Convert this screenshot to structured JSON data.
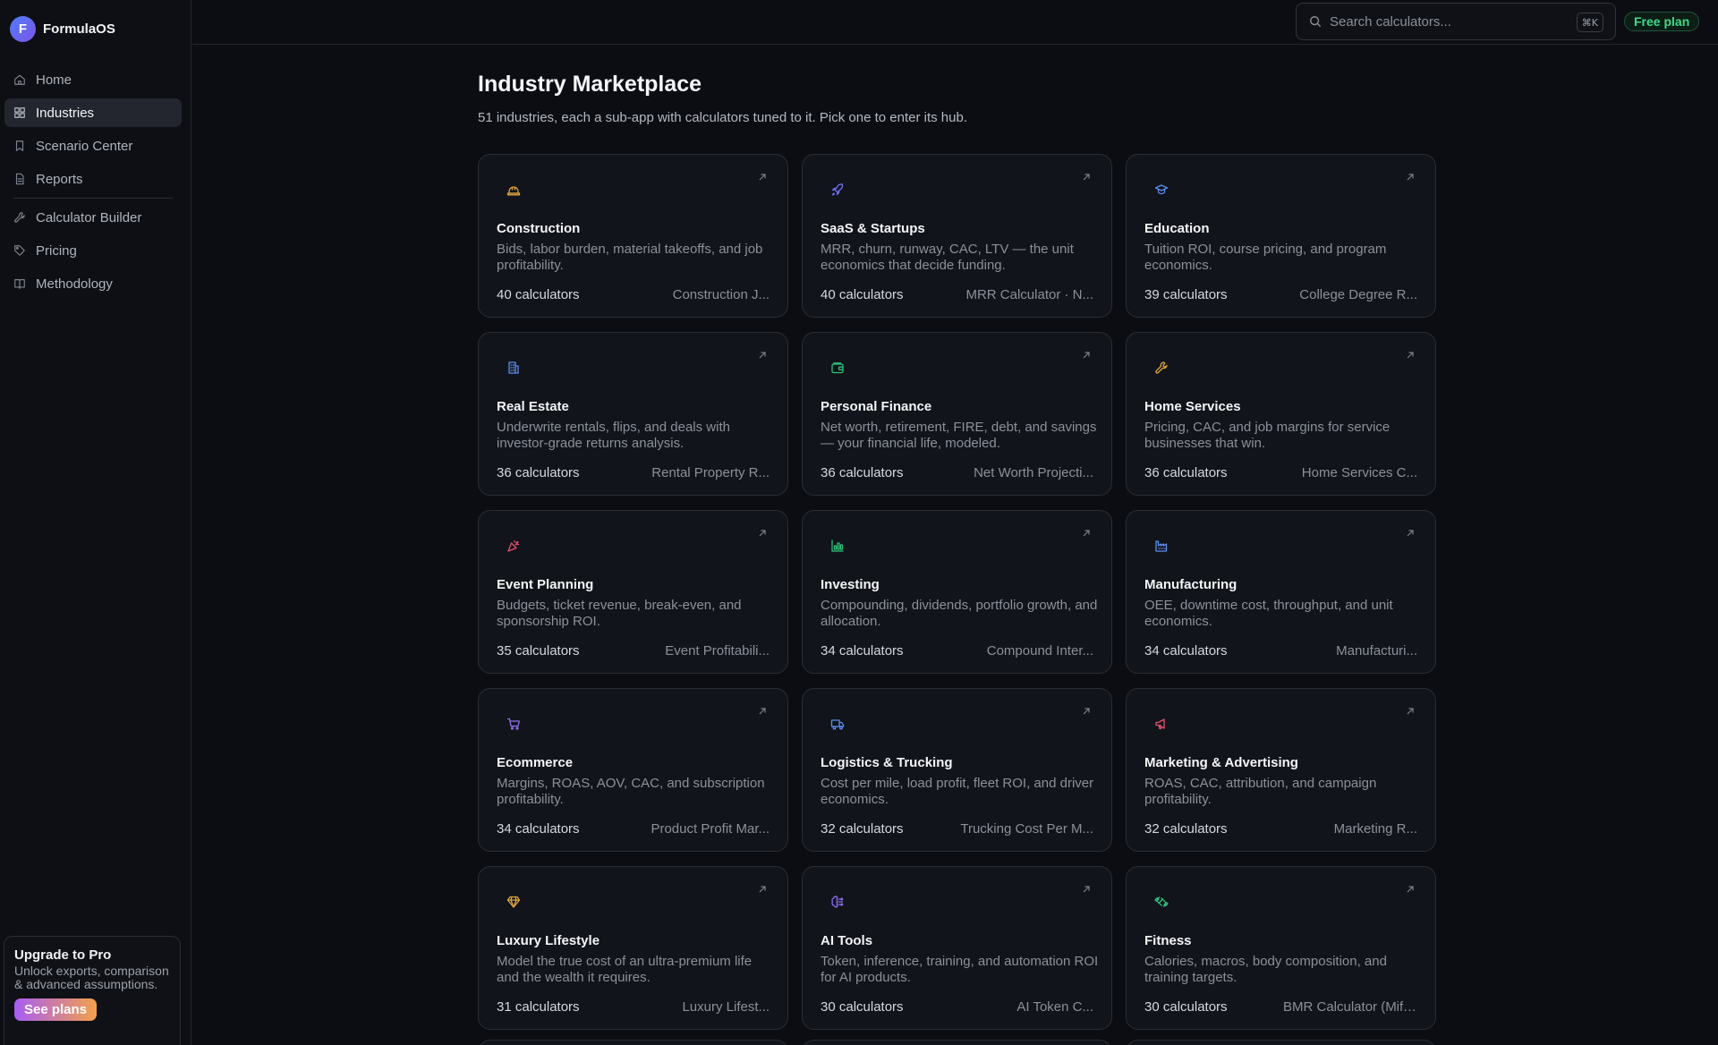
{
  "brand": {
    "logo_letter": "F",
    "name": "FormulaOS"
  },
  "sidebar": {
    "items": [
      {
        "label": "Home",
        "name": "sidebar-item-home",
        "icon": "home-icon"
      },
      {
        "label": "Industries",
        "name": "sidebar-item-industries",
        "icon": "grid-icon",
        "active": true
      },
      {
        "label": "Scenario Center",
        "name": "sidebar-item-scenario-center",
        "icon": "bookmark-icon"
      },
      {
        "label": "Reports",
        "name": "sidebar-item-reports",
        "icon": "file-icon"
      },
      {
        "divider": true
      },
      {
        "label": "Calculator Builder",
        "name": "sidebar-item-calculator-builder",
        "icon": "wrench-icon"
      },
      {
        "label": "Pricing",
        "name": "sidebar-item-pricing",
        "icon": "tag-icon"
      },
      {
        "label": "Methodology",
        "name": "sidebar-item-methodology",
        "icon": "book-icon"
      }
    ],
    "upgrade": {
      "title": "Upgrade to Pro",
      "text": "Unlock exports, comparison & advanced assumptions.",
      "button": "See plans"
    }
  },
  "topbar": {
    "search_placeholder": "Search calculators...",
    "shortcut": "⌘K",
    "plan": "Free plan"
  },
  "page": {
    "title": "Industry Marketplace",
    "subtitle": "51 industries, each a sub-app with calculators tuned to it. Pick one to enter its hub."
  },
  "industries": [
    {
      "title": "Construction",
      "desc": "Bids, labor burden, material takeoffs, and job profitability.",
      "count": "40 calculators",
      "sample": "Construction J...",
      "icon": "hard-hat-icon",
      "color": "#e0a33e"
    },
    {
      "title": "SaaS & Startups",
      "desc": "MRR, churn, runway, CAC, LTV — the unit economics that decide funding.",
      "count": "40 calculators",
      "sample": "MRR Calculator · N...",
      "icon": "rocket-icon",
      "color": "#6f6ef0"
    },
    {
      "title": "Education",
      "desc": "Tuition ROI, course pricing, and program economics.",
      "count": "39 calculators",
      "sample": "College Degree R...",
      "icon": "graduation-cap-icon",
      "color": "#5b8ff2"
    },
    {
      "title": "Real Estate",
      "desc": "Underwrite rentals, flips, and deals with investor-grade returns analysis.",
      "count": "36 calculators",
      "sample": "Rental Property R...",
      "icon": "building-icon",
      "color": "#5b8ff2"
    },
    {
      "title": "Personal Finance",
      "desc": "Net worth, retirement, FIRE, debt, and savings — your financial life, modeled.",
      "count": "36 calculators",
      "sample": "Net Worth Projecti...",
      "icon": "wallet-icon",
      "color": "#2fbf7a"
    },
    {
      "title": "Home Services",
      "desc": "Pricing, CAC, and job margins for service businesses that win.",
      "count": "36 calculators",
      "sample": "Home Services C...",
      "icon": "wrench-icon",
      "color": "#e0a33e"
    },
    {
      "title": "Event Planning",
      "desc": "Budgets, ticket revenue, break-even, and sponsorship ROI.",
      "count": "35 calculators",
      "sample": "Event Profitabili...",
      "icon": "party-popper-icon",
      "color": "#e2506a"
    },
    {
      "title": "Investing",
      "desc": "Compounding, dividends, portfolio growth, and allocation.",
      "count": "34 calculators",
      "sample": "Compound Inter...",
      "icon": "chart-bars-icon",
      "color": "#2fbf7a"
    },
    {
      "title": "Manufacturing",
      "desc": "OEE, downtime cost, throughput, and unit economics.",
      "count": "34 calculators",
      "sample": "Manufacturi...",
      "icon": "factory-icon",
      "color": "#5b8ff2"
    },
    {
      "title": "Ecommerce",
      "desc": "Margins, ROAS, AOV, CAC, and subscription profitability.",
      "count": "34 calculators",
      "sample": "Product Profit Mar...",
      "icon": "cart-icon",
      "color": "#8f6ef0"
    },
    {
      "title": "Logistics & Trucking",
      "desc": "Cost per mile, load profit, fleet ROI, and driver economics.",
      "count": "32 calculators",
      "sample": "Trucking Cost Per M...",
      "icon": "truck-icon",
      "color": "#5b8ff2"
    },
    {
      "title": "Marketing & Advertising",
      "desc": "ROAS, CAC, attribution, and campaign profitability.",
      "count": "32 calculators",
      "sample": "Marketing R...",
      "icon": "megaphone-icon",
      "color": "#e2506a"
    },
    {
      "title": "Luxury Lifestyle",
      "desc": "Model the true cost of an ultra-premium life and the wealth it requires.",
      "count": "31 calculators",
      "sample": "Luxury Lifest...",
      "icon": "gem-icon",
      "color": "#e0a33e"
    },
    {
      "title": "AI Tools",
      "desc": "Token, inference, training, and automation ROI for AI products.",
      "count": "30 calculators",
      "sample": "AI Token C...",
      "icon": "brain-icon",
      "color": "#8f6ef0"
    },
    {
      "title": "Fitness",
      "desc": "Calories, macros, body composition, and training targets.",
      "count": "30 calculators",
      "sample": "BMR Calculator (Miffli...",
      "icon": "dumbbell-icon",
      "color": "#2fbf7a"
    }
  ]
}
